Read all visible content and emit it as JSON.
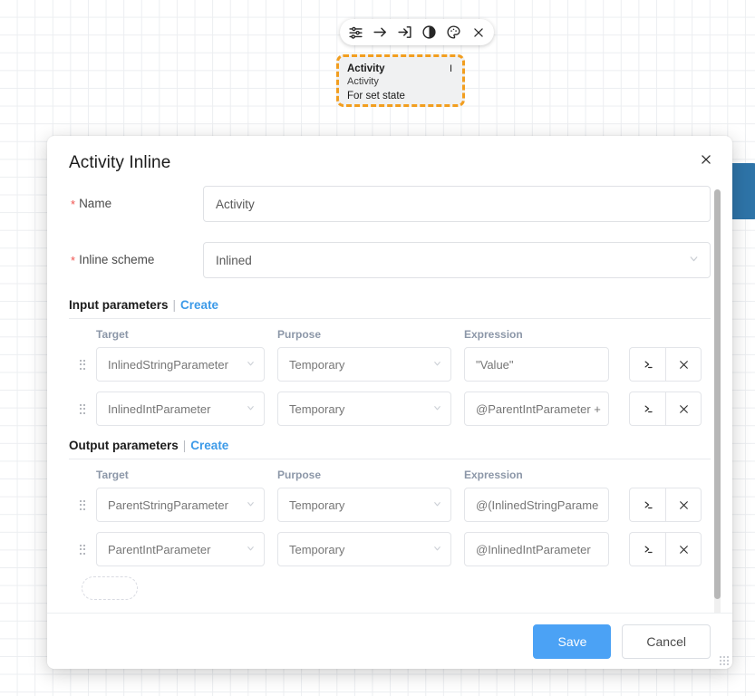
{
  "canvas": {
    "node_toolbar": {
      "icons": [
        {
          "name": "sliders-settings-icon",
          "label": "Settings"
        },
        {
          "name": "arrow-right-icon",
          "label": "Transition"
        },
        {
          "name": "enter-arrow-icon",
          "label": "Enter"
        },
        {
          "name": "contrast-circle-icon",
          "label": "Contrast"
        },
        {
          "name": "palette-icon",
          "label": "Palette"
        },
        {
          "name": "close-x-icon",
          "label": "Close"
        }
      ]
    },
    "activity_node": {
      "title": "Activity",
      "badge": "I",
      "subtitle": "Activity",
      "description": "For set state",
      "border_color": "#f29e1f",
      "background": "#f0f1f2"
    }
  },
  "dialog": {
    "title": "Activity Inline",
    "close_label": "×",
    "fields": [
      {
        "label": "Name",
        "required": true,
        "value": "Activity",
        "placeholder": "",
        "type": "text"
      },
      {
        "label": "Inline scheme",
        "required": true,
        "value": "Inlined",
        "placeholder": "",
        "type": "select"
      }
    ],
    "sections": [
      {
        "id": "input-parameters",
        "title": "Input parameters",
        "divider": "|",
        "create_label": "Create",
        "columns": [
          "Target",
          "Purpose",
          "Expression"
        ],
        "rows": [
          {
            "target": "InlinedStringParameter",
            "purpose": "Temporary",
            "expression": "\"Value\""
          },
          {
            "target": "InlinedIntParameter",
            "purpose": "Temporary",
            "expression": "@ParentIntParameter +"
          }
        ]
      },
      {
        "id": "output-parameters",
        "title": "Output parameters",
        "divider": "|",
        "create_label": "Create",
        "columns": [
          "Target",
          "Purpose",
          "Expression"
        ],
        "rows": [
          {
            "target": "ParentStringParameter",
            "purpose": "Temporary",
            "expression": "@(InlinedStringParame"
          },
          {
            "target": "ParentIntParameter",
            "purpose": "Temporary",
            "expression": "@InlinedIntParameter"
          }
        ]
      }
    ],
    "row_actions": {
      "expression_editor_label": ">_",
      "delete_label": "×"
    },
    "footer": {
      "save_label": "Save",
      "cancel_label": "Cancel",
      "save_color": "#4ba2f5"
    }
  }
}
